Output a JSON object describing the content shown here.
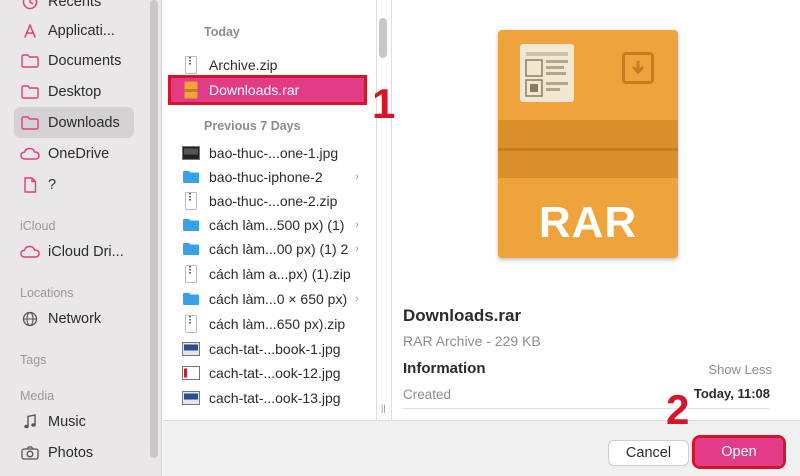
{
  "sidebar": {
    "items_top": [
      {
        "label": "Recents",
        "icon": "clock-icon"
      },
      {
        "label": "Applicati...",
        "icon": "applications-icon"
      },
      {
        "label": "Documents",
        "icon": "folder-icon"
      },
      {
        "label": "Desktop",
        "icon": "folder-icon"
      },
      {
        "label": "Downloads",
        "icon": "folder-icon",
        "selected": true
      },
      {
        "label": "OneDrive",
        "icon": "cloud-icon"
      },
      {
        "label": "?",
        "icon": "document-icon"
      }
    ],
    "icloud_header": "iCloud",
    "icloud_drive": "iCloud Dri...",
    "locations_header": "Locations",
    "network": "Network",
    "tags_header": "Tags",
    "media_header": "Media",
    "music": "Music",
    "photos": "Photos"
  },
  "filelist": {
    "today_header": "Today",
    "today_files": [
      {
        "name": "Archive.zip",
        "type": "zip"
      },
      {
        "name": "Downloads.rar",
        "type": "rar",
        "selected": true
      }
    ],
    "prev_header": "Previous 7 Days",
    "prev_files": [
      {
        "name": "bao-thuc-...one-1.jpg",
        "type": "image-dark"
      },
      {
        "name": "bao-thuc-iphone-2",
        "type": "folder",
        "chevron": true
      },
      {
        "name": "bao-thuc-...one-2.zip",
        "type": "zip"
      },
      {
        "name": "cách làm...500 px) (1)",
        "type": "folder",
        "chevron": true
      },
      {
        "name": "cách làm...00 px) (1) 2",
        "type": "folder",
        "chevron": true
      },
      {
        "name": "cách làm a...px) (1).zip",
        "type": "zip"
      },
      {
        "name": "cách làm...0 × 650 px)",
        "type": "folder",
        "chevron": true
      },
      {
        "name": "cách làm...650 px).zip",
        "type": "zip"
      },
      {
        "name": "cach-tat-...book-1.jpg",
        "type": "image-blue"
      },
      {
        "name": "cach-tat-...ook-12.jpg",
        "type": "image-red"
      },
      {
        "name": "cach-tat-...ook-13.jpg",
        "type": "image-blue"
      }
    ]
  },
  "preview": {
    "icon_text": "RAR",
    "filename": "Downloads.rar",
    "subtitle": "RAR Archive - 229 KB",
    "info_label": "Information",
    "show_less": "Show Less",
    "created_label": "Created",
    "created_value": "Today, 11:08"
  },
  "buttons": {
    "cancel": "Cancel",
    "open": "Open"
  },
  "annotations": {
    "step1": "1",
    "step2": "2"
  },
  "colors": {
    "selection": "#e23c86",
    "annotation_red": "#d4152c",
    "rar_orange": "#eea33d",
    "folder_blue": "#3aa0e8"
  }
}
